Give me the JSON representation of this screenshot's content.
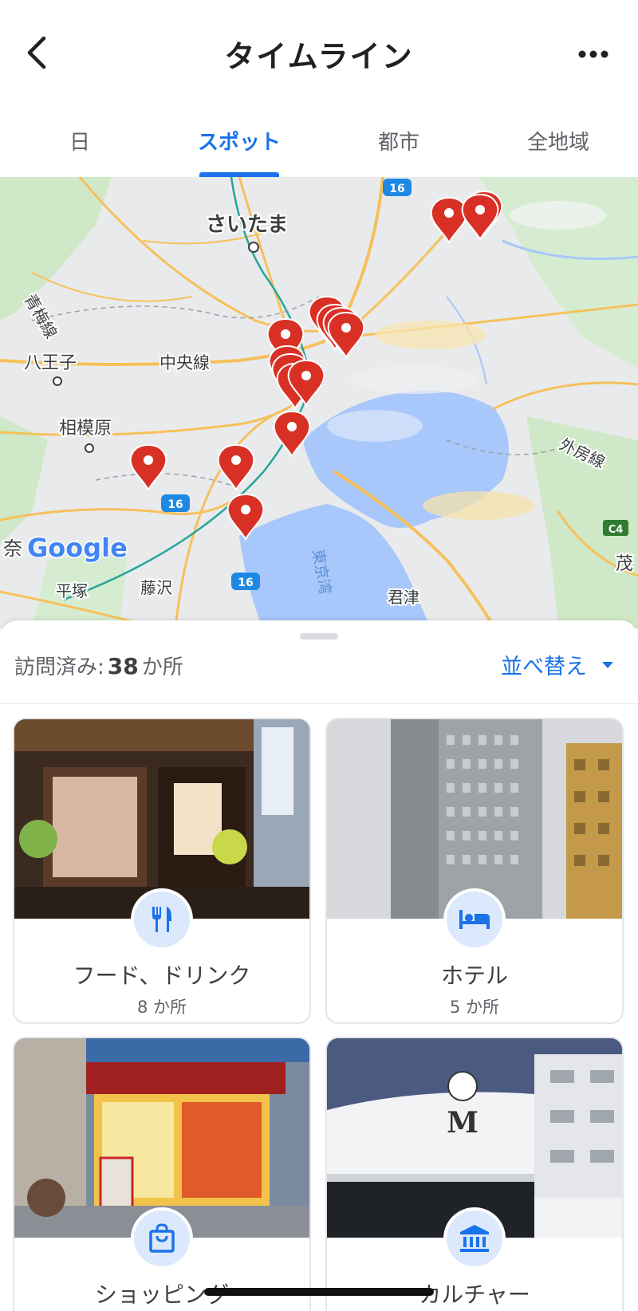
{
  "header": {
    "title": "タイムライン",
    "back_icon": "chevron-left-icon",
    "more_icon": "more-horizontal-icon"
  },
  "tabs": [
    {
      "label": "日",
      "active": false
    },
    {
      "label": "スポット",
      "active": true
    },
    {
      "label": "都市",
      "active": false
    },
    {
      "label": "全地域",
      "active": false
    }
  ],
  "map": {
    "labels": {
      "saitama": "さいたま",
      "ome": "青梅線",
      "hachioji": "八王子",
      "chuo": "中央線",
      "sagamihara": "相模原",
      "sotobo": "外房線",
      "nara": "奈",
      "hiratsuka": "平塚",
      "fujisawa": "藤沢",
      "tokyowan": "東京湾",
      "kimitsu": "君津",
      "mo": "茂",
      "route16": "16",
      "c4": "C4",
      "google": "Google"
    },
    "marker_color": "#d93025",
    "water_color": "#a8c7fa",
    "road_color": "#f6c15b"
  },
  "sheet": {
    "visited_prefix": "訪問済み:",
    "visited_count": "38",
    "visited_suffix": "か所",
    "sort_label": "並べ替え",
    "sort_icon": "caret-down-icon"
  },
  "categories": [
    {
      "label": "フード、ドリンク",
      "count": "8 か所",
      "icon": "restaurant-icon"
    },
    {
      "label": "ホテル",
      "count": "5 か所",
      "icon": "hotel-bed-icon"
    },
    {
      "label": "ショッピング",
      "count": "",
      "icon": "shopping-bag-icon"
    },
    {
      "label": "カルチャー",
      "count": "",
      "icon": "museum-icon"
    }
  ],
  "accent_color": "#1a73e8"
}
